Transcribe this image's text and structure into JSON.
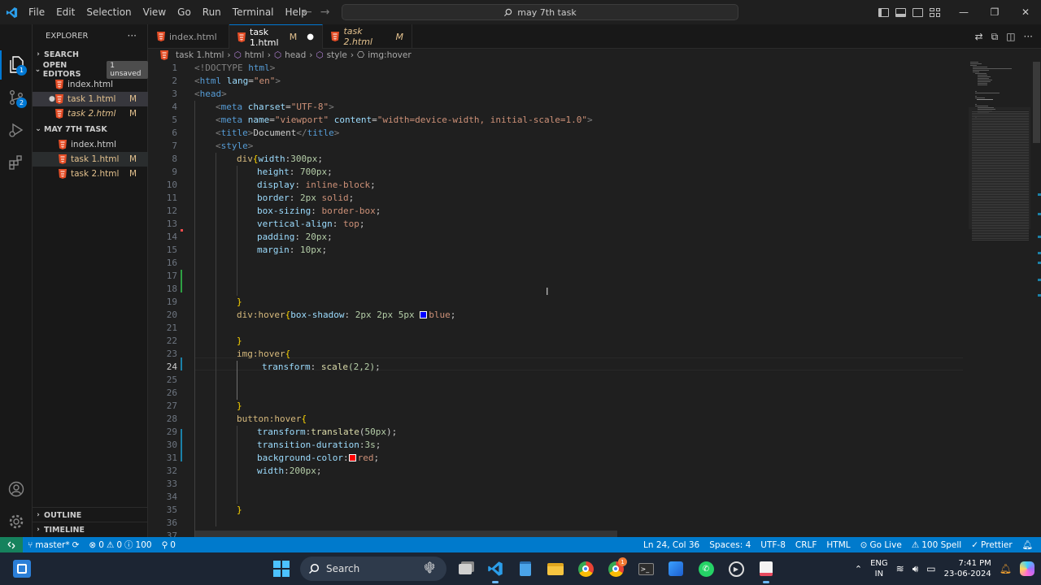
{
  "titlebar": {
    "menu": [
      "File",
      "Edit",
      "Selection",
      "View",
      "Go",
      "Run",
      "Terminal",
      "Help"
    ],
    "search_text": "may 7th task"
  },
  "sidebar": {
    "title": "EXPLORER",
    "search_label": "SEARCH",
    "open_editors_label": "OPEN EDITORS",
    "unsaved_badge": "1 unsaved",
    "open_editors": [
      {
        "name": "index.html",
        "status": ""
      },
      {
        "name": "task 1.html",
        "status": "M"
      },
      {
        "name": "task 2.html",
        "status": "M"
      }
    ],
    "folder_label": "MAY 7TH TASK",
    "files": [
      {
        "name": "index.html",
        "status": ""
      },
      {
        "name": "task 1.html",
        "status": "M"
      },
      {
        "name": "task 2.html",
        "status": "M"
      }
    ],
    "outline_label": "OUTLINE",
    "timeline_label": "TIMELINE"
  },
  "activity": {
    "explorer_badge": "1",
    "scm_badge": "2"
  },
  "tabs": [
    {
      "name": "index.html",
      "status": ""
    },
    {
      "name": "task 1.html",
      "status": "M"
    },
    {
      "name": "task 2.html",
      "status": "M"
    }
  ],
  "breadcrumb": [
    "task 1.html",
    "html",
    "head",
    "style",
    "img:hover"
  ],
  "editor": {
    "active_line": "24",
    "lines": [
      {
        "n": "1"
      },
      {
        "n": "2"
      },
      {
        "n": "3"
      },
      {
        "n": "4"
      },
      {
        "n": "5"
      },
      {
        "n": "6"
      },
      {
        "n": "7"
      },
      {
        "n": "8"
      },
      {
        "n": "9"
      },
      {
        "n": "10"
      },
      {
        "n": "11"
      },
      {
        "n": "12"
      },
      {
        "n": "13"
      },
      {
        "n": "14"
      },
      {
        "n": "15"
      },
      {
        "n": "16"
      },
      {
        "n": "17"
      },
      {
        "n": "18"
      },
      {
        "n": "19"
      },
      {
        "n": "20"
      },
      {
        "n": "21"
      },
      {
        "n": "22"
      },
      {
        "n": "23"
      },
      {
        "n": "24"
      },
      {
        "n": "25"
      },
      {
        "n": "26"
      },
      {
        "n": "27"
      },
      {
        "n": "28"
      },
      {
        "n": "29"
      },
      {
        "n": "30"
      },
      {
        "n": "31"
      },
      {
        "n": "32"
      },
      {
        "n": "33"
      },
      {
        "n": "34"
      },
      {
        "n": "35"
      },
      {
        "n": "36"
      },
      {
        "n": "37"
      }
    ],
    "code": {
      "l1": [
        "<!DOCTYPE",
        " html",
        ">"
      ],
      "l2": [
        "<",
        "html",
        " lang",
        "=",
        "\"en\"",
        ">"
      ],
      "l3": [
        "<",
        "head",
        ">"
      ],
      "l4": [
        "<",
        "meta",
        " charset",
        "=",
        "\"UTF-8\"",
        ">"
      ],
      "l5": [
        "<",
        "meta",
        " name",
        "=",
        "\"viewport\"",
        " content",
        "=",
        "\"width=device-width, initial-scale=1.0\"",
        ">"
      ],
      "l6": [
        "<",
        "title",
        ">",
        "Document",
        "</",
        "title",
        ">"
      ],
      "l7": [
        "<",
        "style",
        ">"
      ],
      "l8": [
        "div",
        "{",
        "width",
        ":",
        "300px",
        ";"
      ],
      "l9": [
        "height",
        ": ",
        "700px",
        ";"
      ],
      "l10": [
        "display",
        ": ",
        "inline-block",
        ";"
      ],
      "l11": [
        "border",
        ": ",
        "2px",
        " solid",
        ";"
      ],
      "l12": [
        "box-sizing",
        ": ",
        "border-box",
        ";"
      ],
      "l13": [
        "vertical-align",
        ": ",
        "top",
        ";"
      ],
      "l14": [
        "padding",
        ": ",
        "20px",
        ";"
      ],
      "l15": [
        "margin",
        ": ",
        "10px",
        ";"
      ],
      "l19": [
        "}"
      ],
      "l20": [
        "div:hover",
        "{",
        "box-shadow",
        ": ",
        "2px 2px 5px ",
        "blue",
        ";"
      ],
      "l22": [
        "}"
      ],
      "l23": [
        "img:hover",
        "{"
      ],
      "l24": [
        "transform",
        ": ",
        "scale",
        "(2,2)",
        ";"
      ],
      "l27": [
        "}"
      ],
      "l28": [
        "button:hover",
        "{"
      ],
      "l29": [
        "transform",
        ":",
        "translate",
        "(",
        "50px",
        ")",
        ";"
      ],
      "l30": [
        "transition-duration",
        ":",
        "3s",
        ";"
      ],
      "l31": [
        "background-color",
        ":",
        "red",
        ";"
      ],
      "l32": [
        "width",
        ":",
        "200px",
        ";"
      ],
      "l35": [
        "}"
      ]
    }
  },
  "statusbar": {
    "branch": "master*",
    "errors": "0",
    "warnings": "0",
    "info": "100",
    "ports": "0",
    "position": "Ln 24, Col 36",
    "spaces": "Spaces: 4",
    "encoding": "UTF-8",
    "eol": "CRLF",
    "language": "HTML",
    "golive": "Go Live",
    "spell": "100 Spell",
    "prettier": "Prettier"
  },
  "taskbar": {
    "search_label": "Search",
    "lang_top": "ENG",
    "lang_bottom": "IN",
    "time": "7:41 PM",
    "date": "23-06-2024",
    "chrome_badge": "1"
  },
  "colors": {
    "accent": "#0078d4",
    "statusbar": "#007acc",
    "modified": "#e2c08d",
    "html_icon": "#e44d26",
    "swatch_blue": "#0000ff",
    "swatch_red": "#ff0000"
  }
}
